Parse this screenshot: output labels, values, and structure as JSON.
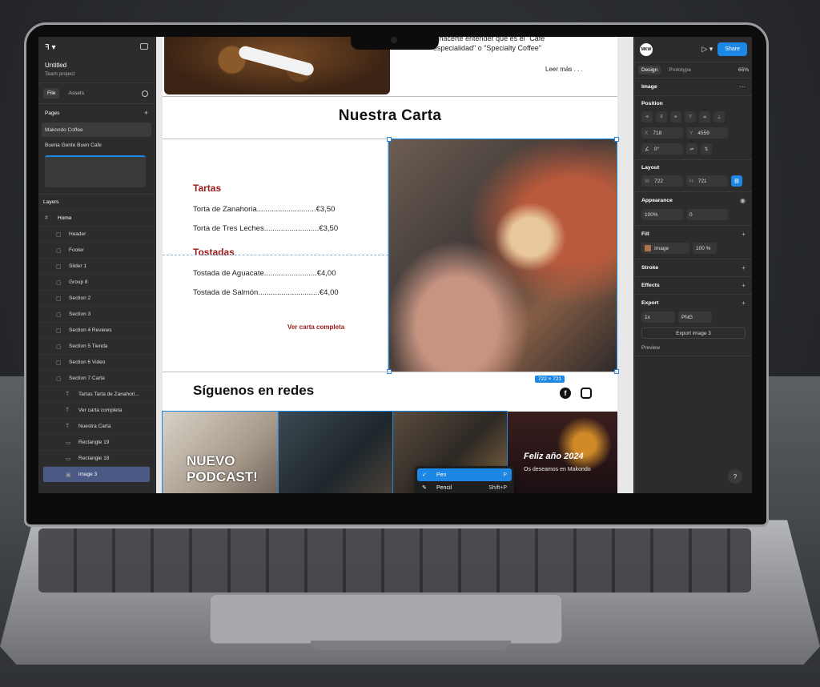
{
  "left_panel": {
    "project_title": "Untitled",
    "project_subtitle": "Team project",
    "tabs": [
      "File",
      "Assets"
    ],
    "pages_label": "Pages",
    "pages": [
      "Makondo Coffee",
      "Buena Gente Buen Cafe"
    ],
    "layers_label": "Layers",
    "layers": [
      {
        "label": "Home",
        "icon": "#"
      },
      {
        "label": "Header",
        "icon": "▢"
      },
      {
        "label": "Footer",
        "icon": "▢"
      },
      {
        "label": "Slider 1",
        "icon": "▢"
      },
      {
        "label": "Group 8",
        "icon": "▢"
      },
      {
        "label": "Section 2",
        "icon": "▢"
      },
      {
        "label": "Section 3",
        "icon": "▢"
      },
      {
        "label": "Section 4 Reviews",
        "icon": "▢"
      },
      {
        "label": "Section 5 Tienda",
        "icon": "▢"
      },
      {
        "label": "Section 6 Video",
        "icon": "▢"
      },
      {
        "label": "Section 7 Carta",
        "icon": "▢"
      },
      {
        "label": "Tartas Tarta de Zanahori...",
        "icon": "T"
      },
      {
        "label": "Ver carta completa",
        "icon": "T"
      },
      {
        "label": "Nuestra Carta",
        "icon": "T"
      },
      {
        "label": "Rectangle 19",
        "icon": "▭"
      },
      {
        "label": "Rectangle 18",
        "icon": "▭"
      },
      {
        "label": "image 3",
        "icon": "▣"
      }
    ]
  },
  "canvas": {
    "top_text": "a hacerte entender que es el \"Cafe\nespecialidad\" o \"Specialty Coffee\"",
    "leer_mas": "Leer más . . .",
    "carta_title": "Nuestra Carta",
    "tartas_heading": "Tartas",
    "tartas_items": [
      "Torta de Zanahoria............................€3,50",
      "Torta de Tres Leches..........................€3,50"
    ],
    "tostadas_heading": "Tostadas",
    "tostadas_items": [
      "Tostada de Aguacate.........................€4,00",
      "Tostada de Salmón.............................€4,00"
    ],
    "ver_carta": "Ver carta completa",
    "dimension_badge": "722 × 721",
    "siguenos": "Síguenos en redes",
    "podcast_text": "NUEVO\nPODCAST!",
    "felix_text": "Feliz año 2024",
    "felix_sub": "Os deseamos en Makondo",
    "pen_menu": [
      {
        "check": "✓",
        "label": "Pen",
        "shortcut": "P"
      },
      {
        "check": "",
        "label": "Pencil",
        "shortcut": "Shift+P"
      }
    ]
  },
  "right_panel": {
    "avatar_text": "MKW",
    "share_label": "Share",
    "tabs": [
      "Design",
      "Prototype"
    ],
    "zoom": "65%",
    "layer_type": "Image",
    "position_label": "Position",
    "x_label": "X",
    "x_value": "718",
    "y_label": "Y",
    "y_value": "4559",
    "rotation": "0°",
    "layout_label": "Layout",
    "w_label": "W",
    "w_value": "722",
    "h_label": "H",
    "h_value": "721",
    "appearance_label": "Appearance",
    "opacity": "100%",
    "corner": "0",
    "fill_label": "Fill",
    "fill_type": "Image",
    "fill_opacity": "100",
    "fill_unit": "%",
    "stroke_label": "Stroke",
    "effects_label": "Effects",
    "export_label": "Export",
    "export_scale": "1x",
    "export_format": "PNG",
    "export_button": "Export image 3",
    "preview_label": "Preview",
    "help": "?"
  },
  "colors": {
    "accent_blue": "#1d87e6",
    "menu_red": "#9b1b1b",
    "panel_bg": "#2c2c2c"
  }
}
